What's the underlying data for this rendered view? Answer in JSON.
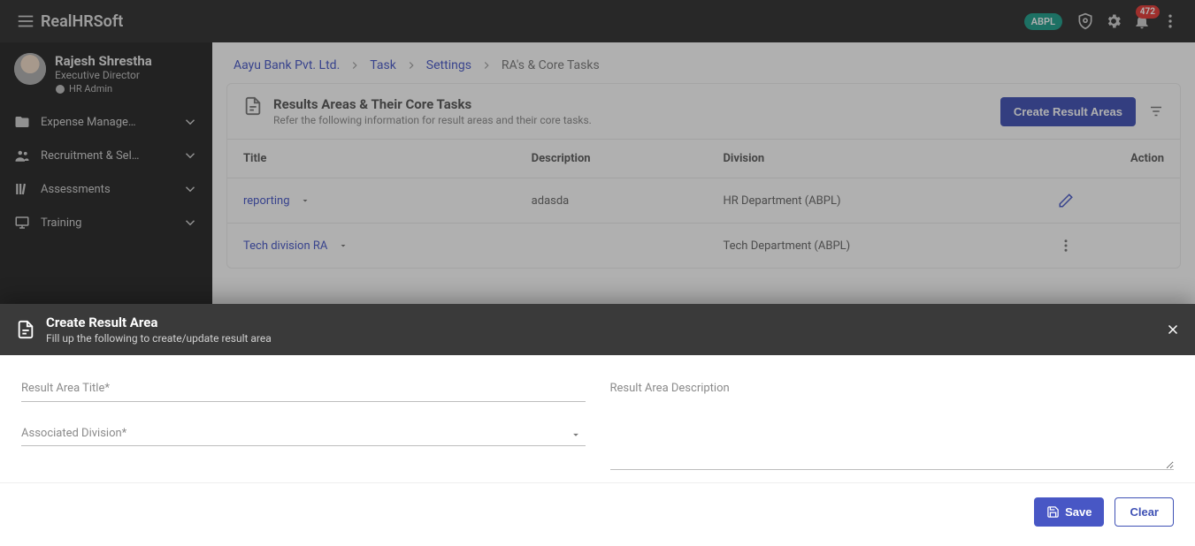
{
  "app": {
    "brand": "RealHRSoft",
    "org_chip": "ABPL",
    "notification_count": "472"
  },
  "profile": {
    "name": "Rajesh Shrestha",
    "role": "Executive Director",
    "tag": "HR Admin"
  },
  "sidebar": {
    "items": [
      {
        "label": "Expense Manage…",
        "icon": "folder-icon"
      },
      {
        "label": "Recruitment & Sel…",
        "icon": "people-icon"
      },
      {
        "label": "Assessments",
        "icon": "library-icon"
      },
      {
        "label": "Training",
        "icon": "presentation-icon"
      }
    ]
  },
  "breadcrumbs": {
    "items": [
      {
        "label": "Aayu Bank Pvt. Ltd.",
        "link": true
      },
      {
        "label": "Task",
        "link": true
      },
      {
        "label": "Settings",
        "link": true
      },
      {
        "label": "RA's & Core Tasks",
        "link": false
      }
    ]
  },
  "card": {
    "title": "Results Areas & Their Core Tasks",
    "subtitle": "Refer the following information for result areas and their core tasks.",
    "create_btn": "Create Result Areas"
  },
  "table": {
    "columns": {
      "title": "Title",
      "description": "Description",
      "division": "Division",
      "action": "Action"
    },
    "rows": [
      {
        "title": "reporting",
        "description": "adasda",
        "division": "HR Department (ABPL)",
        "action": "edit"
      },
      {
        "title": "Tech division RA",
        "description": "",
        "division": "Tech Department (ABPL)",
        "action": "more"
      }
    ]
  },
  "modal": {
    "title": "Create Result Area",
    "subtitle": "Fill up the following to create/update result area",
    "fields": {
      "title_label": "Result Area Title*",
      "division_label": "Associated Division*",
      "description_label": "Result Area Description",
      "title_value": "",
      "division_value": "",
      "description_value": ""
    },
    "buttons": {
      "save": "Save",
      "clear": "Clear"
    }
  }
}
